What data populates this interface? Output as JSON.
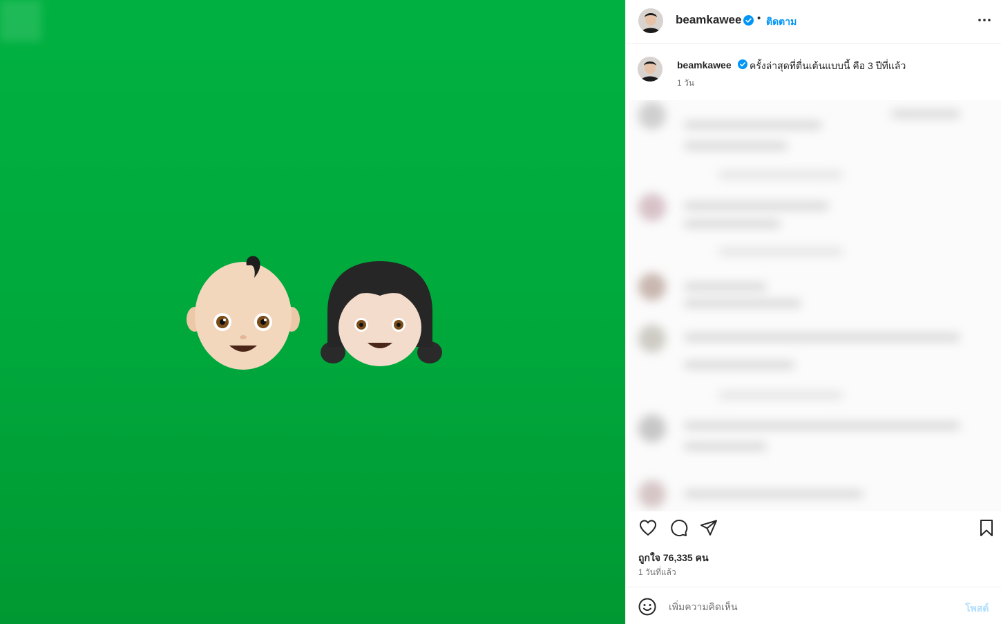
{
  "post": {
    "username": "beamkawee",
    "verified": true,
    "follow_label": "ติดตาม",
    "more_icon": "more-horizontal-icon",
    "media_background": "#00a83c",
    "media_emojis": [
      "baby-emoji",
      "girl-emoji"
    ]
  },
  "caption": {
    "username": "beamkawee",
    "text": "ครั้งล่าสุดที่ตื่นเต้นแบบนี้ คือ 3 ปีที่แล้ว",
    "time": "1 วัน"
  },
  "actions": {
    "like_icon": "heart-icon",
    "comment_icon": "comment-icon",
    "share_icon": "send-icon",
    "save_icon": "bookmark-icon"
  },
  "stats": {
    "likes": "ถูกใจ 76,335 คน",
    "posted": "1 วันที่แล้ว"
  },
  "comment_box": {
    "placeholder": "เพิ่มความคิดเห็น",
    "post_label": "โพสต์"
  },
  "colors": {
    "accent": "#0095f6",
    "post_disabled": "#b2dffc",
    "verified": "#0095f6"
  }
}
